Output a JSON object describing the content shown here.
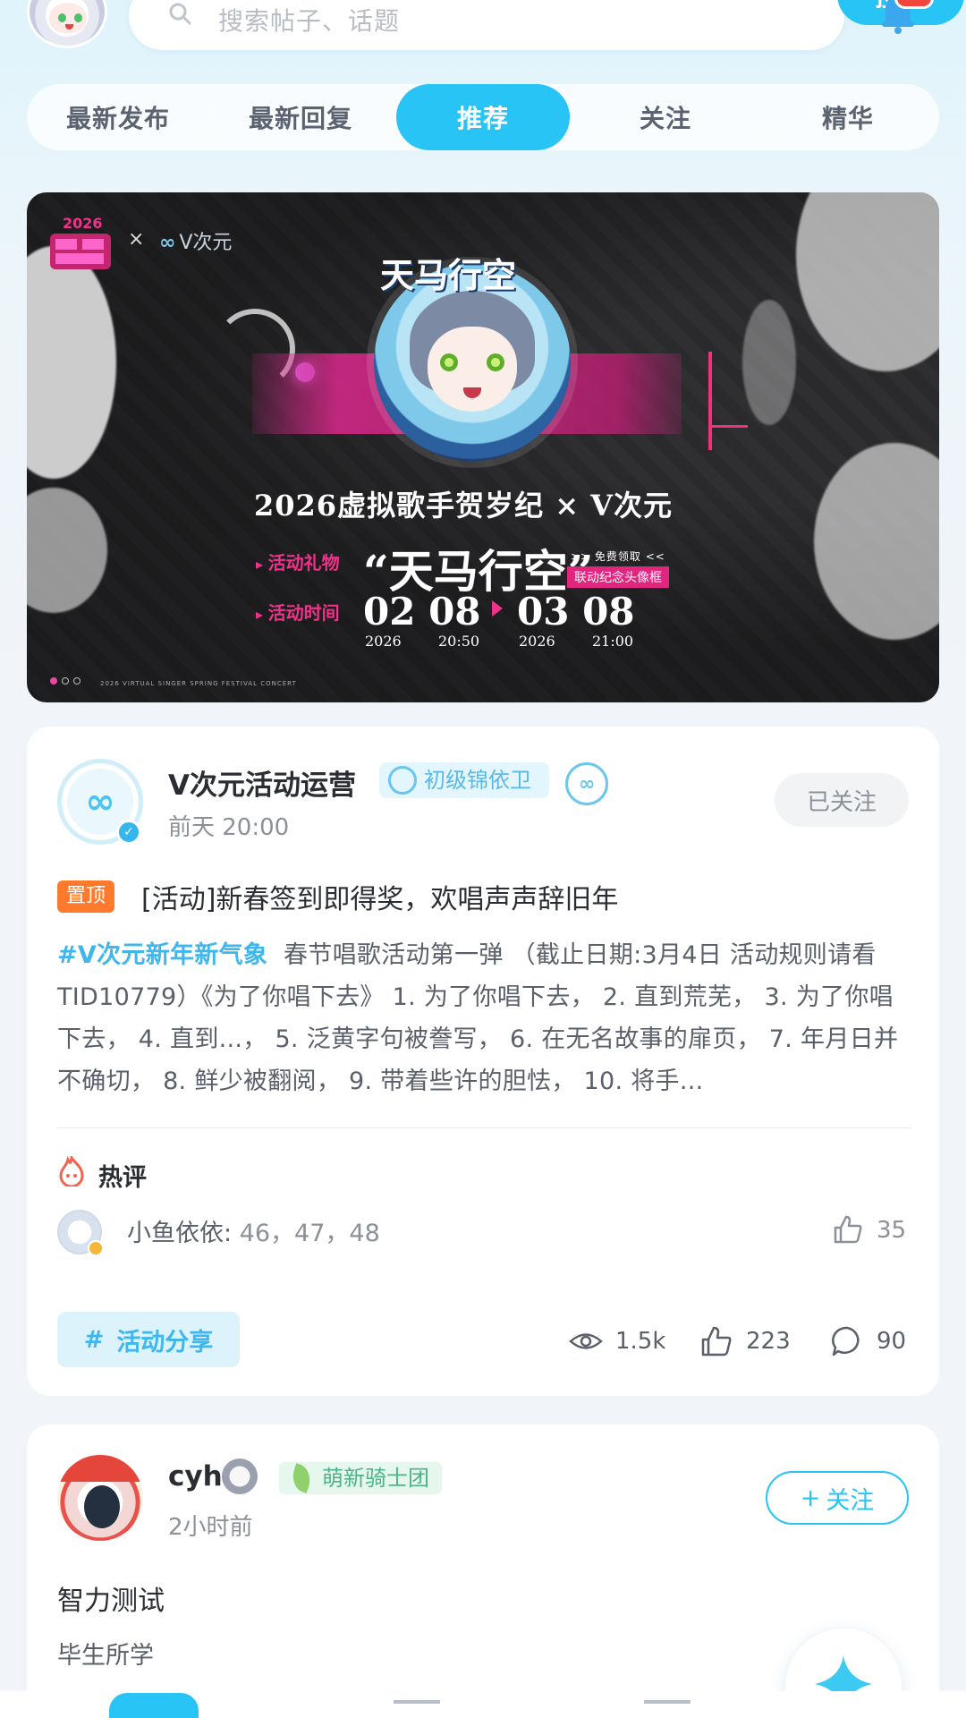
{
  "header": {
    "search_placeholder": "搜索帖子、话题",
    "search_button": "搜索"
  },
  "tabs": [
    "最新发布",
    "最新回复",
    "推荐",
    "关注",
    "精华"
  ],
  "active_tab": "推荐",
  "banner": {
    "partner_logo_text": "V次元",
    "title_art": "天马行空",
    "main_title": "2026虚拟歌手贺岁纪 × V次元",
    "gift_label": "活动礼物",
    "gift_name": "“天马行空”",
    "gift_tag_free": ">> 免费领取 <<",
    "gift_tag_frame": "联动纪念头像框",
    "time_label": "活动时间",
    "start_date": "02 08",
    "start_year": "2026",
    "start_time": "20:50",
    "end_date": "03 08",
    "end_year": "2026",
    "end_time": "21:00",
    "footer_text": "2026 VIRTUAL SINGER SPRING FESTIVAL CONCERT"
  },
  "post1": {
    "author": "V次元活动运营",
    "level_badge": "初级锦依卫",
    "time": "前天 20:00",
    "follow_state": "已关注",
    "pin_label": "置顶",
    "title": "[活动]新春签到即得奖，欢唱声声辞旧年",
    "hashtag": "#V次元新年新气象",
    "body": "春节唱歌活动第一弹 （截止日期:3月4日 活动规则请看TID10779）《为了你唱下去》 1. 为了你唱下去， 2. 直到荒芜， 3. 为了你唱下去， 4. 直到...， 5. 泛黄字句被誊写， 6. 在无名故事的扉页， 7. 年月日并不确切， 8. 鲜少被翻阅， 9. 带着些许的胆怯， 10. 将手...",
    "hot_label": "热评",
    "hot_comment_author": "小鱼依依:",
    "hot_comment_text": "46，47，48",
    "hot_comment_likes": "35",
    "topic": "活动分享",
    "views": "1.5k",
    "likes": "223",
    "comments": "90"
  },
  "post2": {
    "author": "cyh",
    "badge": "萌新骑士团",
    "time": "2小时前",
    "follow_button": "关注",
    "title": "智力测试",
    "body": "毕生所学"
  },
  "colors": {
    "accent": "#27c4f5",
    "pin": "#ff7a2c",
    "hashtag": "#3fb6ee"
  }
}
